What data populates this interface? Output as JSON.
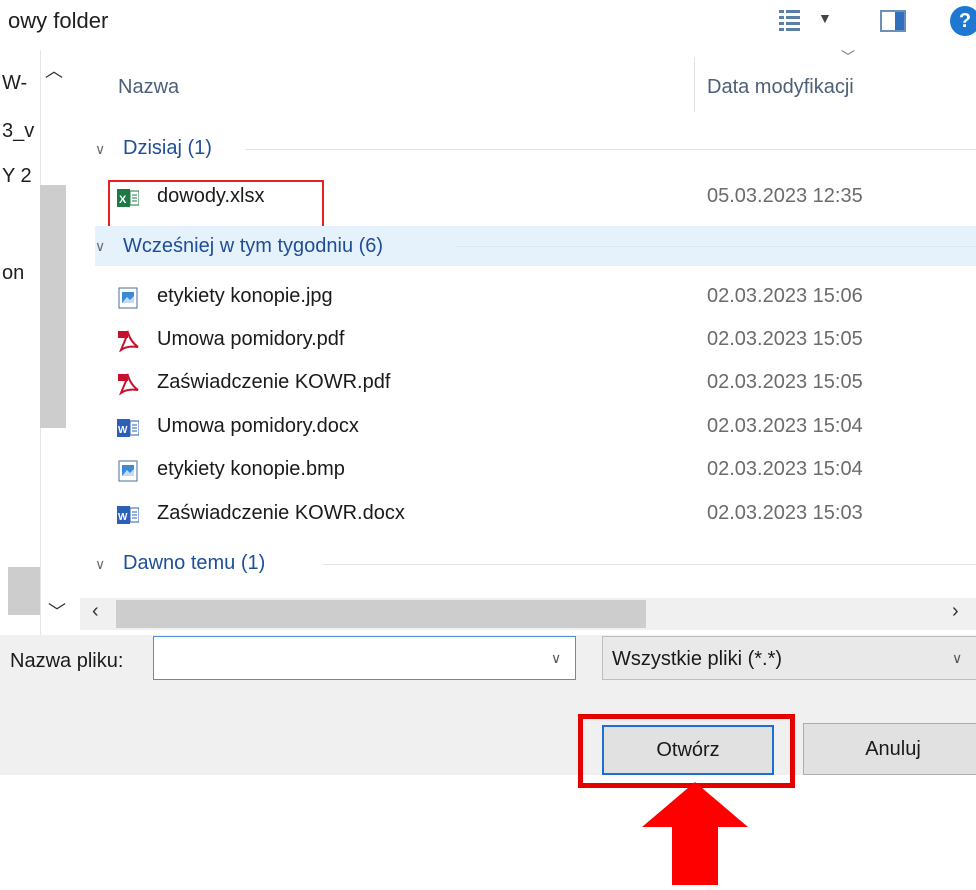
{
  "window": {
    "title_fragment": "owy folder"
  },
  "nav": {
    "items": [
      {
        "label": "W-"
      },
      {
        "label": "3_v"
      },
      {
        "label": "Y 2"
      },
      {
        "label": "on"
      }
    ]
  },
  "columns": {
    "name": "Nazwa",
    "date": "Data modyfikacji"
  },
  "groups": [
    {
      "label": "Dzisiaj (1)"
    },
    {
      "label": "Wcześniej w tym tygodniu (6)"
    },
    {
      "label": "Dawno temu (1)"
    }
  ],
  "files": [
    {
      "name": "dowody.xlsx",
      "date": "05.03.2023 12:35",
      "icon": "excel-icon"
    },
    {
      "name": "etykiety konopie.jpg",
      "date": "02.03.2023 15:06",
      "icon": "image-icon"
    },
    {
      "name": "Umowa pomidory.pdf",
      "date": "02.03.2023 15:05",
      "icon": "pdf-icon"
    },
    {
      "name": "Zaświadczenie KOWR.pdf",
      "date": "02.03.2023 15:05",
      "icon": "pdf-icon"
    },
    {
      "name": "Umowa pomidory.docx",
      "date": "02.03.2023 15:04",
      "icon": "word-icon"
    },
    {
      "name": "etykiety konopie.bmp",
      "date": "02.03.2023 15:04",
      "icon": "image-icon"
    },
    {
      "name": "Zaświadczenie KOWR.docx",
      "date": "02.03.2023 15:03",
      "icon": "word-icon"
    }
  ],
  "bottom": {
    "filename_label": "Nazwa pliku:",
    "filename_value": "",
    "filter_value": "Wszystkie pliki (*.*)",
    "open_label": "Otwórz",
    "cancel_label": "Anuluj"
  },
  "colors": {
    "highlight": "#e50000",
    "group_text": "#1f4e99",
    "selected_row": "#e5f1fb"
  }
}
